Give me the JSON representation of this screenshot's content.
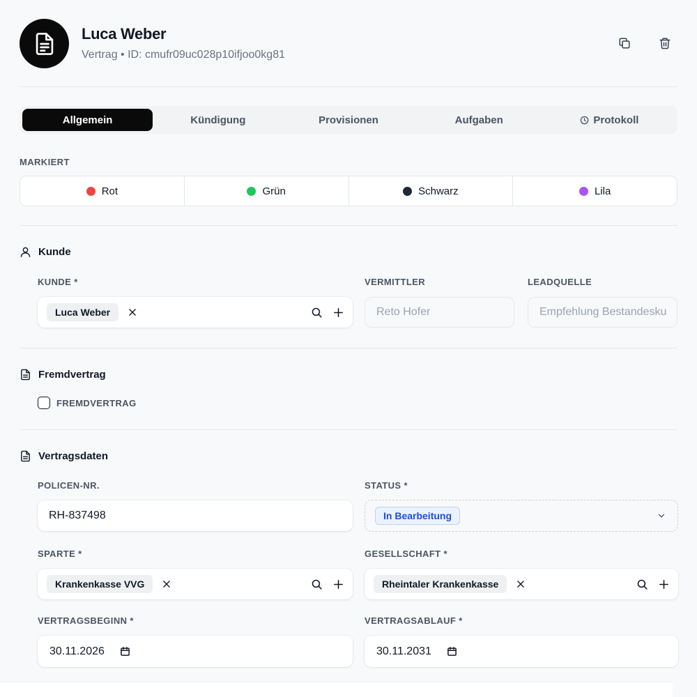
{
  "header": {
    "title": "Luca Weber",
    "subtitle": "Vertrag • ID: cmufr09uc028p10ifjoo0kg81"
  },
  "tabs": [
    {
      "label": "Allgemein",
      "active": true
    },
    {
      "label": "Kündigung",
      "active": false
    },
    {
      "label": "Provisionen",
      "active": false
    },
    {
      "label": "Aufgaben",
      "active": false
    },
    {
      "label": "Protokoll",
      "active": false,
      "icon": "clock-icon"
    }
  ],
  "markiert": {
    "label": "MARKIERT",
    "colors": [
      {
        "label": "Rot",
        "color": "#ef4444"
      },
      {
        "label": "Grün",
        "color": "#22c55e"
      },
      {
        "label": "Schwarz",
        "color": "#1f2937"
      },
      {
        "label": "Lila",
        "color": "#a855f7"
      }
    ]
  },
  "kunde_section": {
    "title": "Kunde",
    "kunde_label": "KUNDE *",
    "kunde_value": "Luca Weber",
    "vermittler_label": "VERMITTLER",
    "vermittler_value": "Reto Hofer",
    "leadquelle_label": "LEADQUELLE",
    "leadquelle_value": "Empfehlung Bestandesku"
  },
  "fremdvertrag_section": {
    "title": "Fremdvertrag",
    "checkbox_label": "FREMDVERTRAG"
  },
  "vertragsdaten_section": {
    "title": "Vertragsdaten",
    "policen_label": "POLICEN-NR.",
    "policen_value": "RH-837498",
    "status_label": "STATUS *",
    "status_value": "In Bearbeitung",
    "sparte_label": "SPARTE *",
    "sparte_value": "Krankenkasse VVG",
    "gesellschaft_label": "GESELLSCHAFT *",
    "gesellschaft_value": "Rheintaler Krankenkasse",
    "beginn_label": "VERTRAGSBEGINN *",
    "beginn_value": "30.11.2026",
    "ablauf_label": "VERTRAGSABLAUF *",
    "ablauf_value": "30.11.2031"
  }
}
